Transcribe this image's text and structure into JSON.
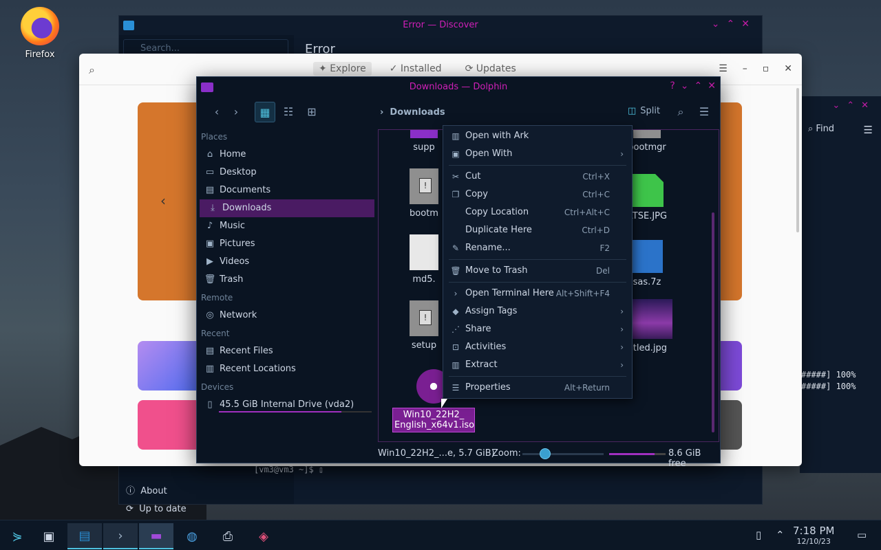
{
  "desktop": {
    "firefox_label": "Firefox"
  },
  "discover": {
    "title": "Error — Discover",
    "search_placeholder": "Search...",
    "heading": "Error",
    "about": "About",
    "up_to_date": "Up to date",
    "terminal_prompt": "[vm3@vm3 ~]$ ▯"
  },
  "white_window": {
    "tabs": [
      {
        "label": "Explore",
        "icon": "✦"
      },
      {
        "label": "Installed",
        "icon": "✓"
      },
      {
        "label": "Updates",
        "icon": "⟳"
      }
    ]
  },
  "right_window": {
    "find": "Find",
    "line1": "#####] 100%",
    "line2": "#####] 100%"
  },
  "dolphin": {
    "title": "Downloads — Dolphin",
    "breadcrumb": "Downloads",
    "split": "Split",
    "places": {
      "places_header": "Places",
      "items": [
        "Home",
        "Desktop",
        "Documents",
        "Downloads",
        "Music",
        "Pictures",
        "Videos",
        "Trash"
      ],
      "remote_header": "Remote",
      "network": "Network",
      "recent_header": "Recent",
      "recent_files": "Recent Files",
      "recent_locations": "Recent Locations",
      "devices_header": "Devices",
      "drive": "45.5 GiB Internal Drive (vda2)"
    },
    "files": {
      "supp": "supp",
      "bootmgr_left": "bootm",
      "md5": "md5.",
      "setup": "setup",
      "bootmgr_right": "bootmgr",
      "atse": "ATSE.JPG",
      "sas": "sas.7z",
      "titled": "titled.jpg",
      "iso_line1": "Win10_22H2_",
      "iso_line2": "English_x64v1.iso"
    },
    "status": {
      "selection": "Win10_22H2_...e, 5.7 GiB)",
      "zoom": "Zoom:",
      "free": "8.6 GiB free"
    }
  },
  "context_menu": {
    "open_with_ark": "Open with Ark",
    "open_with": "Open With",
    "cut": "Cut",
    "cut_sc": "Ctrl+X",
    "copy": "Copy",
    "copy_sc": "Ctrl+C",
    "copy_location": "Copy Location",
    "copy_location_sc": "Ctrl+Alt+C",
    "duplicate": "Duplicate Here",
    "duplicate_sc": "Ctrl+D",
    "rename": "Rename...",
    "rename_sc": "F2",
    "trash": "Move to Trash",
    "trash_sc": "Del",
    "terminal": "Open Terminal Here",
    "terminal_sc": "Alt+Shift+F4",
    "assign_tags": "Assign Tags",
    "share": "Share",
    "activities": "Activities",
    "extract": "Extract",
    "properties": "Properties",
    "properties_sc": "Alt+Return"
  },
  "taskbar": {
    "time": "7:18 PM",
    "date": "12/10/23"
  },
  "colors": {
    "accent_magenta": "#d01fb8",
    "accent_cyan": "#4fc3e0",
    "selection_purple": "#7a1f92"
  }
}
